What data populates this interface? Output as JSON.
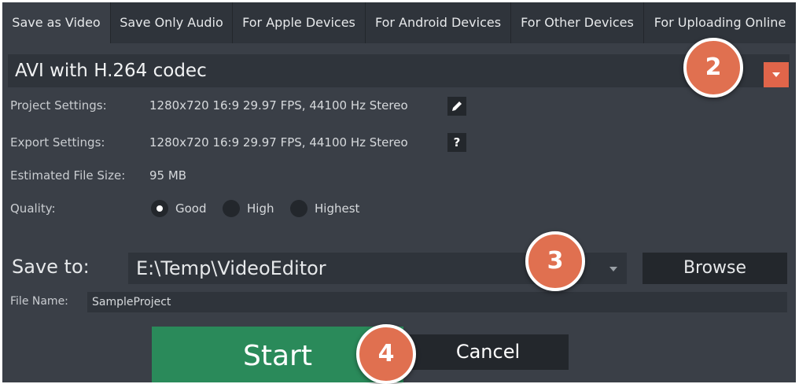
{
  "tabs": [
    {
      "label": "Save as Video",
      "active": true
    },
    {
      "label": "Save Only Audio",
      "active": false
    },
    {
      "label": "For Apple Devices",
      "active": false
    },
    {
      "label": "For Android Devices",
      "active": false
    },
    {
      "label": "For Other Devices",
      "active": false
    },
    {
      "label": "For Uploading Online",
      "active": false
    }
  ],
  "format": {
    "value": "AVI with H.264 codec",
    "dropdown_icon": "chevron-down-icon"
  },
  "project_settings": {
    "label": "Project Settings:",
    "value": "1280x720 16:9 29.97 FPS, 44100 Hz Stereo",
    "icon": "pencil-icon"
  },
  "export_settings": {
    "label": "Export Settings:",
    "value": "1280x720 16:9 29.97 FPS, 44100 Hz Stereo",
    "help": "?"
  },
  "file_size": {
    "label": "Estimated File Size:",
    "value": "95 MB"
  },
  "quality": {
    "label": "Quality:",
    "options": [
      "Good",
      "High",
      "Highest"
    ],
    "selected": "Good"
  },
  "save_to": {
    "label": "Save to:",
    "path": "E:\\Temp\\VideoEditor",
    "browse_label": "Browse"
  },
  "file_name": {
    "label": "File Name:",
    "value": "SampleProject"
  },
  "buttons": {
    "start": "Start",
    "cancel": "Cancel"
  },
  "callouts": [
    "2",
    "3",
    "4"
  ],
  "colors": {
    "accent": "#e0654a",
    "start": "#2a8a5a",
    "panel": "#3a3f47",
    "field": "#2f343b",
    "badge": "#e07050"
  }
}
